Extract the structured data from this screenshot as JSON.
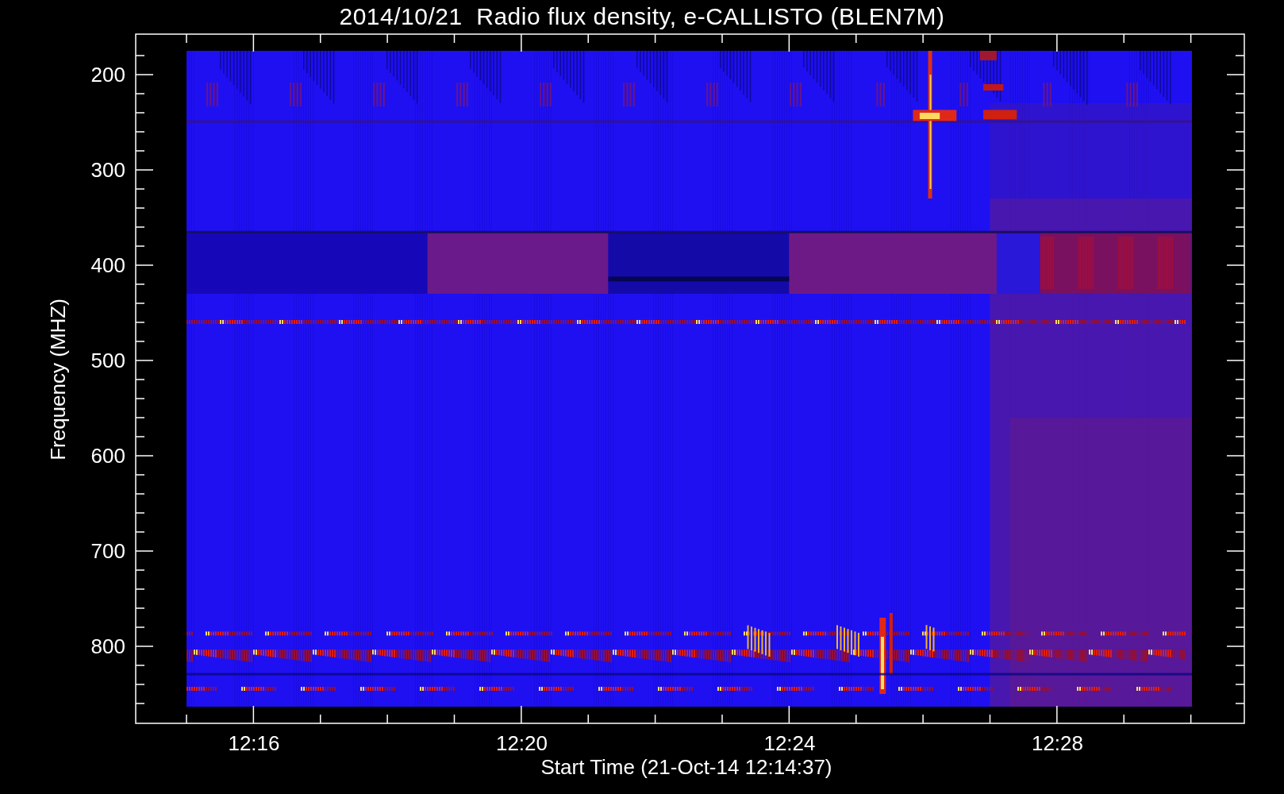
{
  "title": "2014/10/21  Radio flux density, e-CALLISTO (BLEN7M)",
  "y_axis": {
    "label": "Frequency (MHZ)",
    "ticks": [
      "200",
      "300",
      "400",
      "500",
      "600",
      "700",
      "800"
    ]
  },
  "x_axis": {
    "label": "Start Time (21-Oct-14 12:14:37)",
    "ticks": [
      "12:16",
      "12:20",
      "12:24",
      "12:28"
    ]
  }
}
